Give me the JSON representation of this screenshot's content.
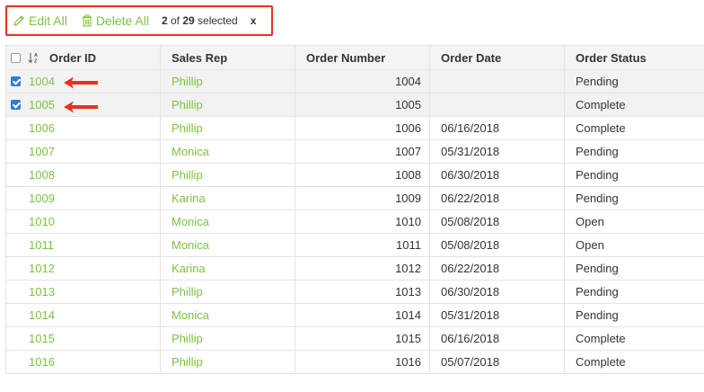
{
  "toolbar": {
    "edit_all_label": "Edit All",
    "delete_all_label": "Delete All",
    "selected_count": "2",
    "selected_of": " of ",
    "total_count": "29",
    "selected_suffix": " selected",
    "clear_label": "x"
  },
  "table": {
    "columns": [
      "Order ID",
      "Sales Rep",
      "Order Number",
      "Order Date",
      "Order Status"
    ],
    "rows": [
      {
        "id": "1004",
        "rep": "Phillip",
        "num": "1004",
        "date": "",
        "status": "Pending",
        "selected": true
      },
      {
        "id": "1005",
        "rep": "Phillip",
        "num": "1005",
        "date": "",
        "status": "Complete",
        "selected": true
      },
      {
        "id": "1006",
        "rep": "Phillip",
        "num": "1006",
        "date": "06/16/2018",
        "status": "Complete",
        "selected": false
      },
      {
        "id": "1007",
        "rep": "Monica",
        "num": "1007",
        "date": "05/31/2018",
        "status": "Pending",
        "selected": false
      },
      {
        "id": "1008",
        "rep": "Phillip",
        "num": "1008",
        "date": "06/30/2018",
        "status": "Pending",
        "selected": false
      },
      {
        "id": "1009",
        "rep": "Karina",
        "num": "1009",
        "date": "06/22/2018",
        "status": "Pending",
        "selected": false
      },
      {
        "id": "1010",
        "rep": "Monica",
        "num": "1010",
        "date": "05/08/2018",
        "status": "Open",
        "selected": false
      },
      {
        "id": "1011",
        "rep": "Monica",
        "num": "1011",
        "date": "05/08/2018",
        "status": "Open",
        "selected": false
      },
      {
        "id": "1012",
        "rep": "Karina",
        "num": "1012",
        "date": "06/22/2018",
        "status": "Pending",
        "selected": false
      },
      {
        "id": "1013",
        "rep": "Phillip",
        "num": "1013",
        "date": "06/30/2018",
        "status": "Pending",
        "selected": false
      },
      {
        "id": "1014",
        "rep": "Monica",
        "num": "1014",
        "date": "05/31/2018",
        "status": "Pending",
        "selected": false
      },
      {
        "id": "1015",
        "rep": "Phillip",
        "num": "1015",
        "date": "06/16/2018",
        "status": "Complete",
        "selected": false
      },
      {
        "id": "1016",
        "rep": "Phillip",
        "num": "1016",
        "date": "05/07/2018",
        "status": "Complete",
        "selected": false
      }
    ]
  },
  "colors": {
    "accent": "#7cc242",
    "highlight": "#e8321e",
    "checkbox": "#2f7bd8"
  },
  "icons": {
    "edit": "pencil-icon",
    "delete": "trash-icon",
    "sort": "sort-az-icon",
    "annotation": "arrow-left-icon"
  }
}
